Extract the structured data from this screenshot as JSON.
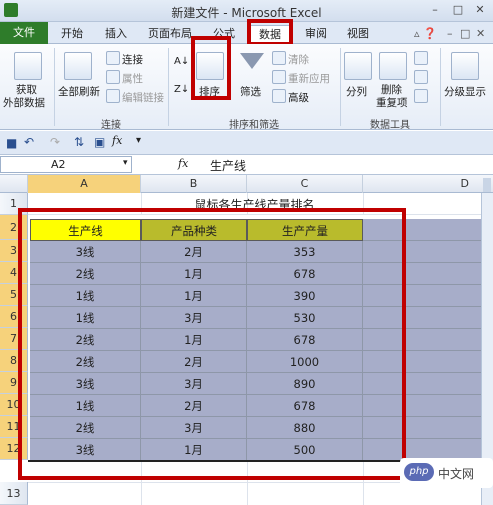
{
  "window": {
    "title": "新建文件 - Microsoft Excel",
    "minimize": "–",
    "restore": "□",
    "close": "✕"
  },
  "tabs": {
    "file": "文件",
    "items": [
      "开始",
      "插入",
      "页面布局",
      "公式",
      "数据",
      "审阅",
      "视图"
    ],
    "active": "数据"
  },
  "ribbon": {
    "get_external": "获取\n外部数据",
    "get_external_l1": "获取",
    "get_external_l2": "外部数据",
    "refresh_all": "全部刷新",
    "connections": "连接",
    "properties": "属性",
    "edit_links": "编辑链接",
    "group_connections": "连接",
    "sort": "排序",
    "filter": "筛选",
    "clear": "清除",
    "reapply": "重新应用",
    "advanced": "高级",
    "group_sort_filter": "排序和筛选",
    "text_to_columns": "分列",
    "remove_duplicates_l1": "删除",
    "remove_duplicates_l2": "重复项",
    "group_data_tools": "数据工具",
    "outline": "分级显示"
  },
  "formula_bar": {
    "name_box": "A2",
    "fx": "fx",
    "formula": "生产线"
  },
  "grid": {
    "columns": [
      "A",
      "B",
      "C",
      "D"
    ],
    "rows": [
      "1",
      "2",
      "3",
      "4",
      "5",
      "6",
      "7",
      "8",
      "9",
      "10",
      "11",
      "12",
      "13"
    ],
    "title": "鼠标各生产线产量排名",
    "headers": [
      "生产线",
      "产品种类",
      "生产产量"
    ],
    "data": [
      [
        "3线",
        "2月",
        "353"
      ],
      [
        "2线",
        "1月",
        "678"
      ],
      [
        "1线",
        "1月",
        "390"
      ],
      [
        "1线",
        "3月",
        "530"
      ],
      [
        "2线",
        "1月",
        "678"
      ],
      [
        "2线",
        "2月",
        "1000"
      ],
      [
        "3线",
        "3月",
        "890"
      ],
      [
        "1线",
        "2月",
        "678"
      ],
      [
        "2线",
        "3月",
        "880"
      ],
      [
        "3线",
        "1月",
        "500"
      ]
    ]
  },
  "watermark": "php 中文网",
  "colors": {
    "highlight_red": "#c00000",
    "file_tab": "#2e7c2a",
    "header_yellow": "#ffff00",
    "header_olive": "#b9bb2c",
    "data_fill": "#a7adc9"
  }
}
